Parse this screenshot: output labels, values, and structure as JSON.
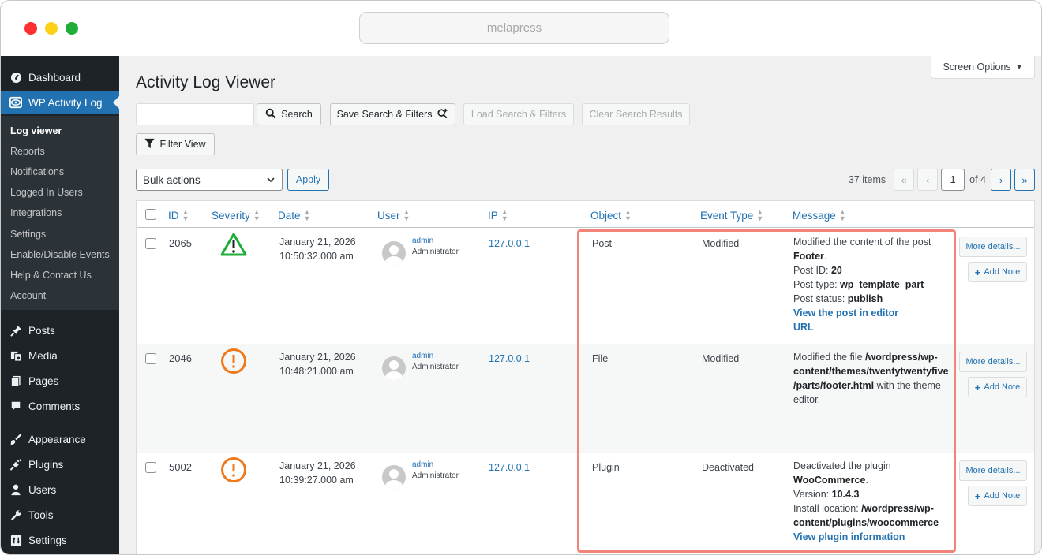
{
  "browser": {
    "url": "melapress"
  },
  "sidebar": {
    "top_items": [
      {
        "label": "Dashboard",
        "icon": "dashboard-icon"
      },
      {
        "label": "WP Activity Log",
        "icon": "activity-log-icon"
      }
    ],
    "submenu": [
      "Log viewer",
      "Reports",
      "Notifications",
      "Logged In Users",
      "Integrations",
      "Settings",
      "Enable/Disable Events",
      "Help & Contact Us",
      "Account"
    ],
    "items": [
      {
        "label": "Posts",
        "icon": "pin-icon"
      },
      {
        "label": "Media",
        "icon": "media-icon"
      },
      {
        "label": "Pages",
        "icon": "pages-icon"
      },
      {
        "label": "Comments",
        "icon": "comments-icon"
      },
      {
        "label": "Appearance",
        "icon": "brush-icon"
      },
      {
        "label": "Plugins",
        "icon": "plugin-icon"
      },
      {
        "label": "Users",
        "icon": "users-icon"
      },
      {
        "label": "Tools",
        "icon": "wrench-icon"
      },
      {
        "label": "Settings",
        "icon": "settings-icon"
      }
    ]
  },
  "header": {
    "screen_options": "Screen Options",
    "title": "Activity Log Viewer"
  },
  "toolbar": {
    "search_button": "Search",
    "save_button": "Save Search & Filters",
    "load_button": "Load Search & Filters",
    "clear_button": "Clear Search Results",
    "filter_button": "Filter View",
    "bulk_actions": "Bulk actions",
    "apply": "Apply"
  },
  "pagination": {
    "items": "37 items",
    "first": "«",
    "prev": "‹",
    "current": "1",
    "of": "of 4",
    "next": "›",
    "last": "»"
  },
  "table": {
    "columns": [
      "ID",
      "Severity",
      "Date",
      "User",
      "IP",
      "Object",
      "Event Type",
      "Message"
    ],
    "rows": [
      {
        "id": "2065",
        "severity": "warning-triangle",
        "date": "January 21, 2026",
        "time": "10:50:32.000 am",
        "user": "admin",
        "role": "Administrator",
        "ip": "127.0.0.1",
        "object": "Post",
        "event_type": "Modified",
        "message": {
          "l1": "Modified the content of the post",
          "l2": "Footer",
          "l2_suffix": ".",
          "l3_label": "Post ID: ",
          "l3_value": "20",
          "l4_label": "Post type: ",
          "l4_value": "wp_template_part",
          "l5_label": "Post status: ",
          "l5_value": "publish",
          "link1": "View the post in editor",
          "link2": "URL"
        },
        "more": "More details...",
        "add_note": "Add Note"
      },
      {
        "id": "2046",
        "severity": "alert-circle",
        "date": "January 21, 2026",
        "time": "10:48:21.000 am",
        "user": "admin",
        "role": "Administrator",
        "ip": "127.0.0.1",
        "object": "File",
        "event_type": "Modified",
        "message": {
          "l1_prefix": "Modified the file ",
          "l1_bold": "/wordpress/wp-",
          "l2": "content/themes/twentytwentyfive",
          "l3_bold": "/parts/footer.html",
          "l3_suffix": " with the theme",
          "l4": "editor."
        },
        "more": "More details...",
        "add_note": "Add Note"
      },
      {
        "id": "5002",
        "severity": "alert-circle",
        "date": "January 21, 2026",
        "time": "10:39:27.000 am",
        "user": "admin",
        "role": "Administrator",
        "ip": "127.0.0.1",
        "object": "Plugin",
        "event_type": "Deactivated",
        "message": {
          "l1": "Deactivated the plugin",
          "l2": "WooCommerce",
          "l2_suffix": ".",
          "l3_label": "Version: ",
          "l3_value": "10.4.3",
          "l4_label": "Install location: ",
          "l4_value": "/wordpress/wp-",
          "l5": "content/plugins/woocommerce",
          "link1": "View plugin information"
        },
        "more": "More details...",
        "add_note": "Add Note"
      }
    ]
  },
  "colors": {
    "accent": "#2271b1",
    "sidebar": "#1d2327",
    "warning_green": "#1fae3a",
    "alert_orange": "#f07a1b",
    "highlight": "#f2847a"
  }
}
